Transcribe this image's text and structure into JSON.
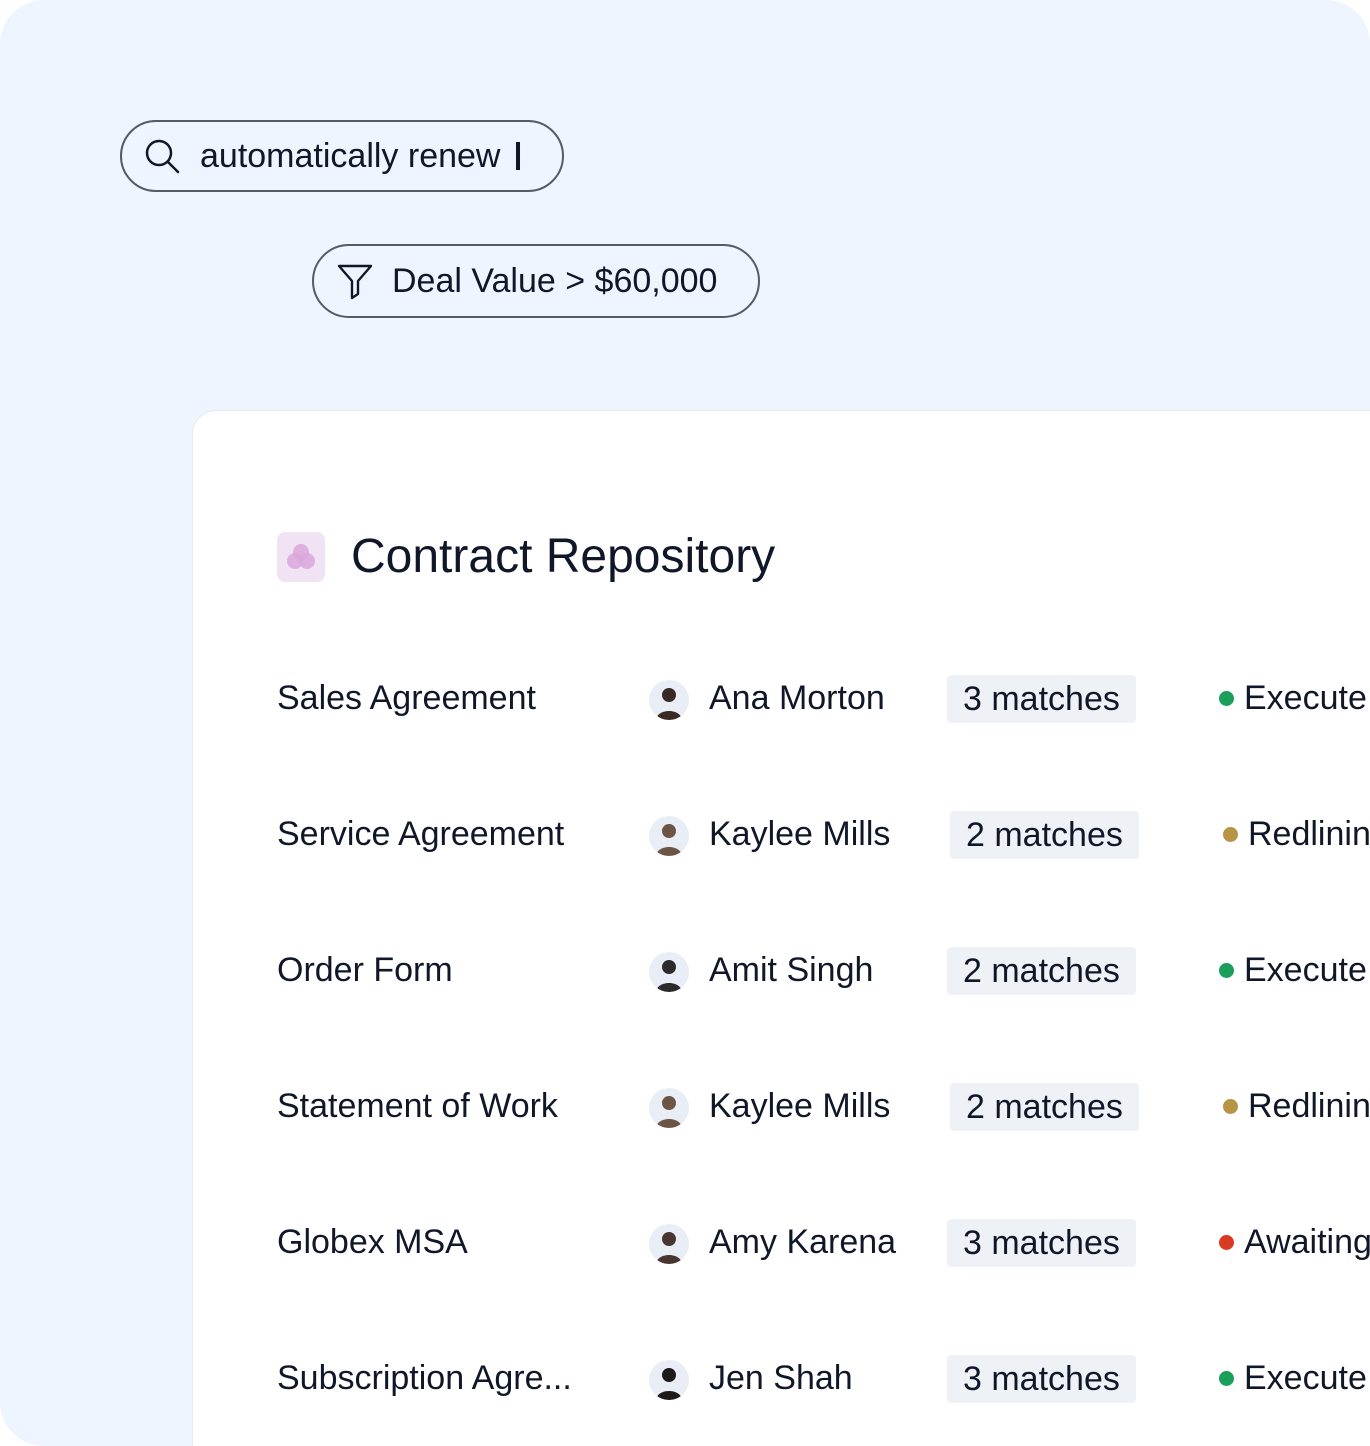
{
  "search": {
    "query": "automatically renew"
  },
  "filter": {
    "label": "Deal Value > $60,000"
  },
  "repository": {
    "title": "Contract Repository",
    "rows": [
      {
        "name": "Sales Agreement",
        "owner": "Ana Morton",
        "matches": "3 matches",
        "status": "Execute",
        "status_color": "#1aa05a",
        "avatar_color": "#3a2a24"
      },
      {
        "name": "Service Agreement",
        "owner": "Kaylee Mills",
        "matches": "2 matches",
        "status": "Redlinin",
        "status_color": "#b89444",
        "avatar_color": "#6d5546"
      },
      {
        "name": "Order Form",
        "owner": "Amit Singh",
        "matches": "2 matches",
        "status": "Execute",
        "status_color": "#1aa05a",
        "avatar_color": "#2b2b2b"
      },
      {
        "name": "Statement of Work",
        "owner": "Kaylee Mills",
        "matches": "2 matches",
        "status": "Redlinin",
        "status_color": "#b89444",
        "avatar_color": "#6d5546"
      },
      {
        "name": "Globex MSA",
        "owner": "Amy Karena",
        "matches": "3 matches",
        "status": "Awaiting",
        "status_color": "#d83a22",
        "avatar_color": "#4a3630"
      },
      {
        "name": "Subscription Agre...",
        "owner": "Jen Shah",
        "matches": "3 matches",
        "status": "Execute",
        "status_color": "#1aa05a",
        "avatar_color": "#1f1a1a"
      }
    ]
  }
}
